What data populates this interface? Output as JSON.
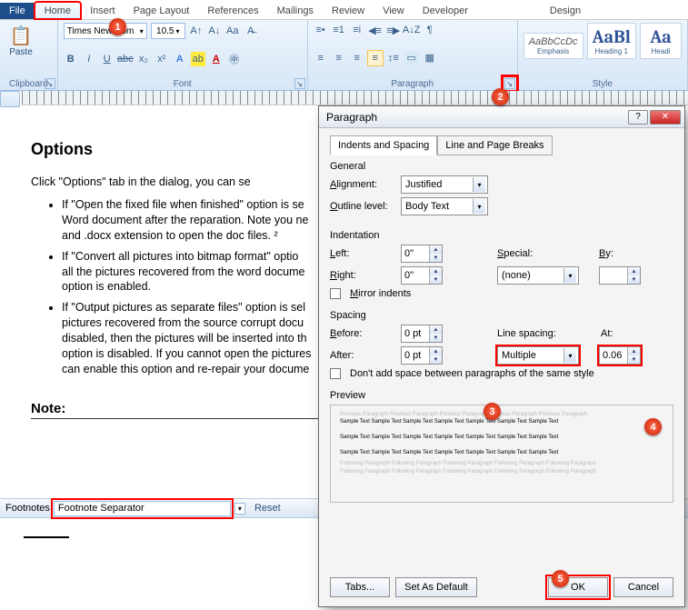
{
  "tabs": {
    "file": "File",
    "home": "Home",
    "insert": "Insert",
    "pagelayout": "Page Layout",
    "references": "References",
    "mailings": "Mailings",
    "review": "Review",
    "view": "View",
    "developer": "Developer",
    "design": "Design"
  },
  "ribbon": {
    "clipboard": {
      "label": "Clipboard",
      "paste": "Paste"
    },
    "font": {
      "label": "Font",
      "name": "Times New Rom",
      "size": "10.5",
      "bold": "B",
      "italic": "I",
      "underline": "U",
      "strike": "abc",
      "sub": "x₂",
      "sup": "x²",
      "grow": "A˄",
      "shrink": "A˅",
      "case": "Aa",
      "clear": "⌫"
    },
    "paragraph": {
      "label": "Paragraph"
    },
    "styles": {
      "label": "Style",
      "emphasis_preview": "AaBbCcDc",
      "emphasis": "Emphasis",
      "heading1_preview": "AaBl",
      "heading1": "Heading 1",
      "heading2_preview": "Aa",
      "heading2": "Headi"
    }
  },
  "doc": {
    "title": "Options",
    "intro": "Click \"Options\" tab in the dialog, you can se",
    "li1": "If \"Open the fixed file when finished\" option is se",
    "li1b": "Word document after the reparation. Note you ne",
    "li1c": "and .docx extension to open the doc files. ²",
    "li2": "If \"Convert all pictures into bitmap format\" optio",
    "li2b": "all the pictures recovered from the word docume",
    "li2c": "option is enabled.",
    "li3": "If \"Output pictures as separate files\" option is sel",
    "li3b": "pictures recovered from the source corrupt docu",
    "li3c": "disabled, then the pictures will be inserted into th",
    "li3d": "option is disabled. If you cannot open the pictures",
    "li3e": "can enable this option and re-repair your docume",
    "note": "Note:"
  },
  "footbar": {
    "label": "Footnotes",
    "value": "Footnote Separator",
    "reset": "Reset"
  },
  "dialog": {
    "title": "Paragraph",
    "tab1": "Indents and Spacing",
    "tab2": "Line and Page Breaks",
    "general": "General",
    "alignment_lbl": "Alignment:",
    "alignment_val": "Justified",
    "outline_lbl": "Outline level:",
    "outline_val": "Body Text",
    "indentation": "Indentation",
    "left_lbl": "Left:",
    "left_val": "0\"",
    "right_lbl": "Right:",
    "right_val": "0\"",
    "special_lbl": "Special:",
    "special_val": "(none)",
    "by_lbl": "By:",
    "by_val": "",
    "mirror": "Mirror indents",
    "spacing": "Spacing",
    "before_lbl": "Before:",
    "before_val": "0 pt",
    "after_lbl": "After:",
    "after_val": "0 pt",
    "linesp_lbl": "Line spacing:",
    "linesp_val": "Multiple",
    "at_lbl": "At:",
    "at_val": "0.06",
    "nospace": "Don't add space between paragraphs of the same style",
    "preview": "Preview",
    "preview_text_faint": "Previous Paragraph Previous Paragraph Previous Paragraph Previous Paragraph Previous Paragraph",
    "preview_text": "Sample Text Sample Text Sample Text Sample Text Sample Text Sample Text Sample Text",
    "preview_text_follow": "Following Paragraph Following Paragraph Following Paragraph Following Paragraph Following Paragraph",
    "btn_tabs": "Tabs...",
    "btn_default": "Set As Default",
    "btn_ok": "OK",
    "btn_cancel": "Cancel"
  },
  "markers": {
    "m1": "1",
    "m2": "2",
    "m3": "3",
    "m4": "4",
    "m5": "5"
  }
}
